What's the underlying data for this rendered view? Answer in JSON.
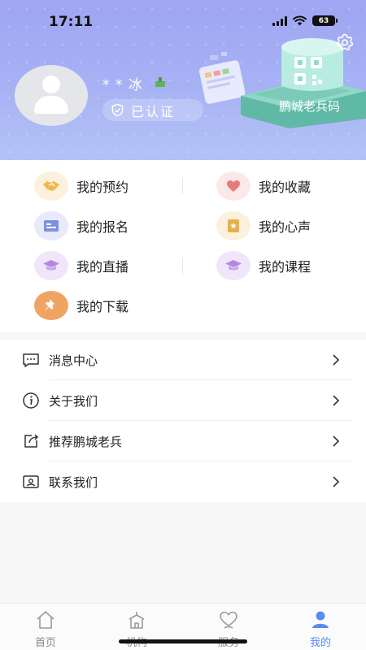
{
  "status_bar": {
    "time": "17:11",
    "battery": "63"
  },
  "profile": {
    "username": "* * 冰",
    "verified_label": "已认证",
    "qr_label": "鹏城老兵码"
  },
  "colors": {
    "header": "#a3acf3",
    "accent": "#5a8cf0",
    "background": "#f6f6f7"
  },
  "menu_grid": [
    {
      "label": "我的预约",
      "icon": "handshake-icon"
    },
    {
      "label": "我的收藏",
      "icon": "heart-icon"
    },
    {
      "label": "我的报名",
      "icon": "signup-card-icon"
    },
    {
      "label": "我的心声",
      "icon": "voice-note-icon"
    },
    {
      "label": "我的直播",
      "icon": "live-cap-icon"
    },
    {
      "label": "我的课程",
      "icon": "course-cap-icon"
    },
    {
      "label": "我的下载",
      "icon": "pin-icon"
    }
  ],
  "list": [
    {
      "label": "消息中心",
      "icon": "message-icon"
    },
    {
      "label": "关于我们",
      "icon": "info-icon"
    },
    {
      "label": "推荐鹏城老兵",
      "icon": "share-icon"
    },
    {
      "label": "联系我们",
      "icon": "contact-card-icon"
    }
  ],
  "tabs": [
    {
      "label": "首页",
      "icon": "home-icon"
    },
    {
      "label": "机构",
      "icon": "institution-icon"
    },
    {
      "label": "服务",
      "icon": "service-heart-icon"
    },
    {
      "label": "我的",
      "icon": "user-icon",
      "active": true
    }
  ]
}
